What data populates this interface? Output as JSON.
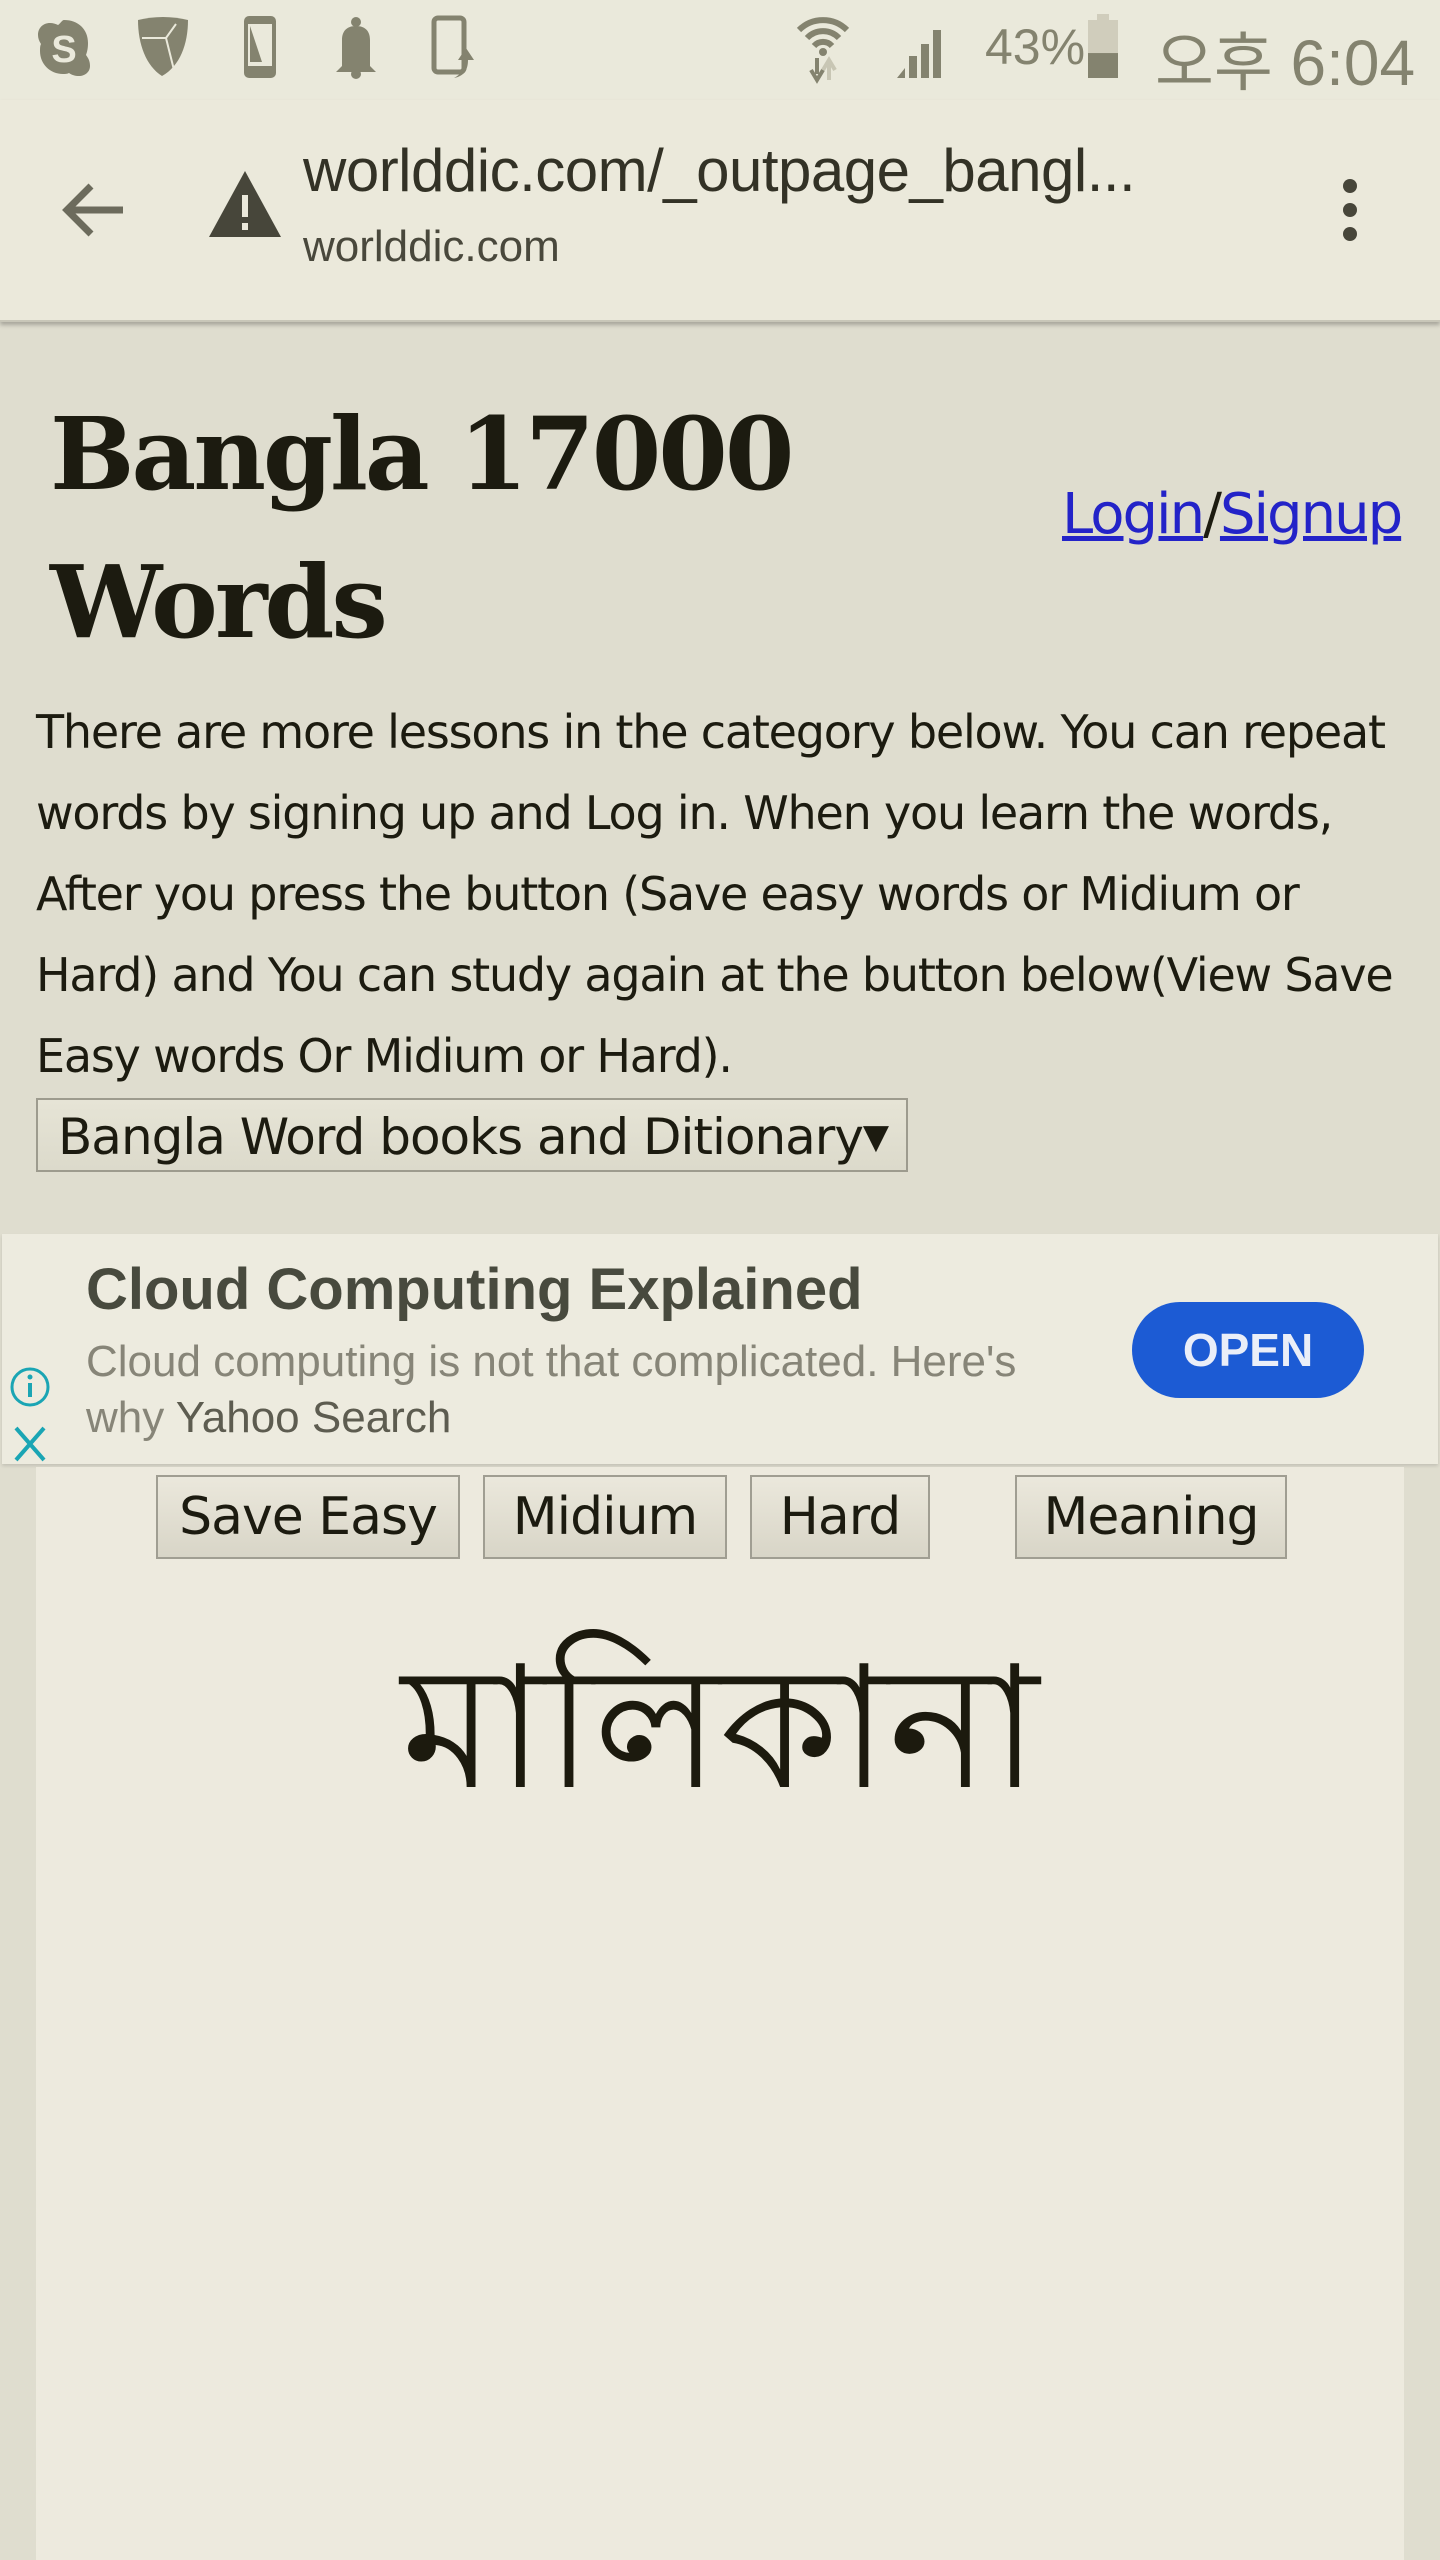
{
  "status_bar": {
    "left_icons": [
      "skype-icon",
      "shield-icon",
      "phone-screen-icon",
      "bell-icon",
      "phone-upload-icon"
    ],
    "right_icons": [
      "wifi-icon",
      "signal-icon",
      "battery-icon"
    ],
    "battery_percent": "43%",
    "battery_level": 0.43,
    "time": "오후 6:04"
  },
  "browser": {
    "url": "worlddic.com/_outpage_bangl...",
    "domain": "worlddic.com",
    "security_icon": "warning-icon"
  },
  "page": {
    "title": "Bangla 17000 Words",
    "login_label": "Login",
    "separator": "/",
    "signup_label": "Signup",
    "intro_text": "There are more lessons in the category below. You can repeat words by signing up and Log in. When you learn the words, After you press the button (Save easy words or Midium or Hard) and You can study again at the button below(View Save Easy words Or Midium or Hard).",
    "category_select": {
      "selected": "Bangla Word books and Ditionary",
      "arrow": "▼"
    }
  },
  "ad": {
    "title": "Cloud Computing Explained",
    "body": "Cloud computing is not that complicated. Here's why",
    "brand": "Yahoo Search",
    "open_label": "OPEN",
    "accent_color": "#1c5bd4",
    "icon_color": "#1aa5b4"
  },
  "card": {
    "buttons": [
      "Save Easy",
      "Midium",
      "Hard",
      "Meaning"
    ],
    "word": "মালিকানা"
  }
}
